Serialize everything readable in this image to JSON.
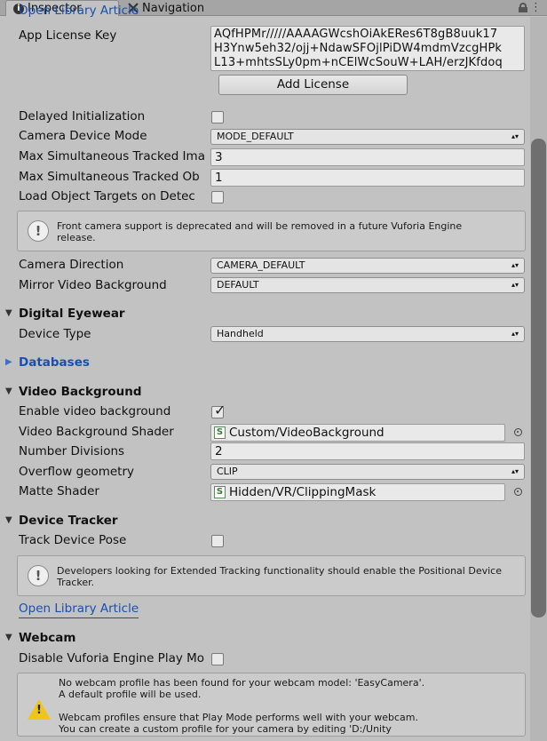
{
  "tabs": [
    {
      "label": "Inspector",
      "icon": "info-icon"
    },
    {
      "label": "Navigation",
      "icon": "navigation-icon"
    }
  ],
  "top_link": "Open Library Article",
  "license": {
    "label": "App License Key",
    "lines": [
      "AQfHPMr/////AAAAGWcshOiAkERes6T8gB8uuk17",
      "H3Ynw5eh32/ojj+NdawSFOjlPiDW4mdmVzcgHPk",
      "L13+mhtsSLy0pm+nCElWcSouW+LAH/erzJKfdoq"
    ],
    "add_button": "Add License"
  },
  "fields": {
    "delayed_init": {
      "label": "Delayed Initialization",
      "checked": false
    },
    "camera_device_mode": {
      "label": "Camera Device Mode",
      "value": "MODE_DEFAULT"
    },
    "max_images": {
      "label": "Max Simultaneous Tracked Ima",
      "value": "3"
    },
    "max_objects": {
      "label": "Max Simultaneous Tracked Ob",
      "value": "1"
    },
    "load_object_targets": {
      "label": "Load Object Targets on Detec",
      "checked": false
    },
    "camera_direction": {
      "label": "Camera Direction",
      "value": "CAMERA_DEFAULT"
    },
    "mirror_video": {
      "label": "Mirror Video Background",
      "value": "DEFAULT"
    }
  },
  "front_camera_help": {
    "line1": "Front camera support is deprecated and will be removed in a future Vuforia Engine",
    "line2": "release."
  },
  "digital_eyewear": {
    "header": "Digital Eyewear",
    "device_type": {
      "label": "Device Type",
      "value": "Handheld"
    }
  },
  "databases": {
    "header": "Databases"
  },
  "video_background": {
    "header": "Video Background",
    "enable": {
      "label": "Enable video background",
      "checked": true
    },
    "shader": {
      "label": "Video Background Shader",
      "value": "Custom/VideoBackground"
    },
    "divisions": {
      "label": "Number Divisions",
      "value": "2"
    },
    "overflow": {
      "label": "Overflow geometry",
      "value": "CLIP"
    },
    "matte": {
      "label": "Matte Shader",
      "value": "Hidden/VR/ClippingMask"
    }
  },
  "device_tracker": {
    "header": "Device Tracker",
    "track_pose": {
      "label": "Track Device Pose",
      "checked": false
    },
    "help_line1": "Developers looking for Extended Tracking functionality should enable the Positional Device",
    "help_line2": "Tracker.",
    "link": "Open Library Article"
  },
  "webcam": {
    "header": "Webcam",
    "disable_play_mode": {
      "label": "Disable Vuforia Engine Play Mo",
      "checked": false
    },
    "warn_line1": "No webcam profile has been found for your webcam model: 'EasyCamera'.",
    "warn_line2": "A default profile will be used.",
    "warn_line3": "Webcam profiles ensure that Play Mode performs well with your webcam.",
    "warn_line4": "You can create a custom profile for your camera by editing  'D:/Unity"
  }
}
